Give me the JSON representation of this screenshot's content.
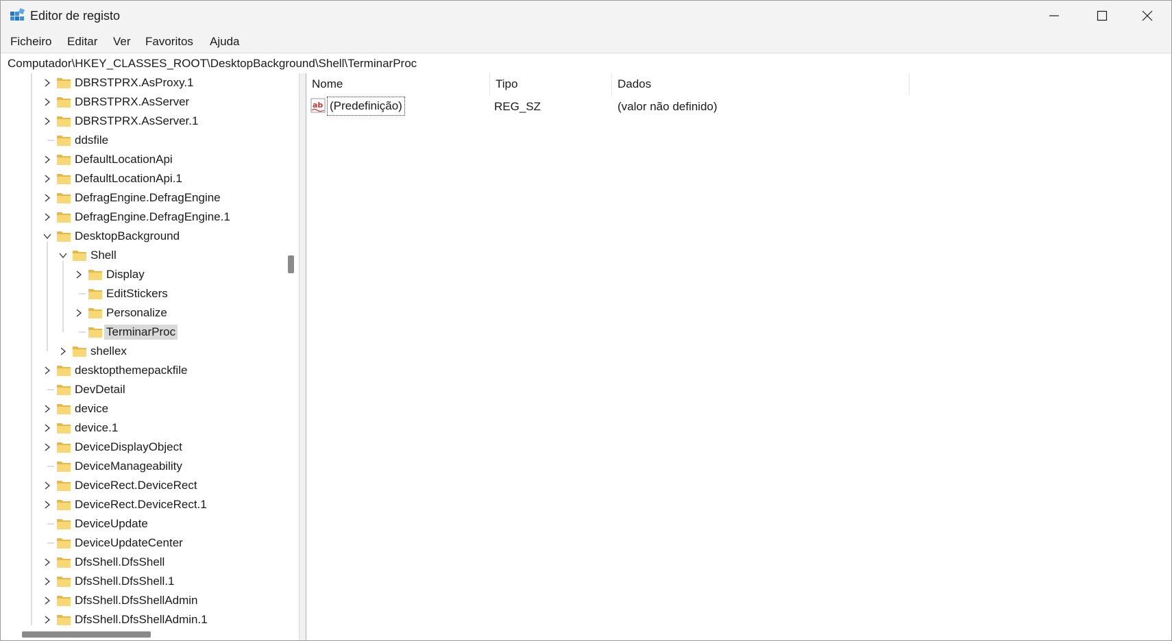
{
  "window": {
    "title": "Editor de registo"
  },
  "menu": [
    "Ficheiro",
    "Editar",
    "Ver",
    "Favoritos",
    "Ajuda"
  ],
  "address": "Computador\\HKEY_CLASSES_ROOT\\DesktopBackground\\Shell\\TerminarProc",
  "tree": [
    {
      "label": "DBRSTPRX.AsProxy.1",
      "level": 0,
      "expander": "collapsed"
    },
    {
      "label": "DBRSTPRX.AsServer",
      "level": 0,
      "expander": "collapsed"
    },
    {
      "label": "DBRSTPRX.AsServer.1",
      "level": 0,
      "expander": "collapsed"
    },
    {
      "label": "ddsfile",
      "level": 0,
      "expander": "none"
    },
    {
      "label": "DefaultLocationApi",
      "level": 0,
      "expander": "collapsed"
    },
    {
      "label": "DefaultLocationApi.1",
      "level": 0,
      "expander": "collapsed"
    },
    {
      "label": "DefragEngine.DefragEngine",
      "level": 0,
      "expander": "collapsed"
    },
    {
      "label": "DefragEngine.DefragEngine.1",
      "level": 0,
      "expander": "collapsed"
    },
    {
      "label": "DesktopBackground",
      "level": 0,
      "expander": "expanded"
    },
    {
      "label": "Shell",
      "level": 1,
      "expander": "expanded"
    },
    {
      "label": "Display",
      "level": 2,
      "expander": "collapsed"
    },
    {
      "label": "EditStickers",
      "level": 2,
      "expander": "none"
    },
    {
      "label": "Personalize",
      "level": 2,
      "expander": "collapsed"
    },
    {
      "label": "TerminarProc",
      "level": 2,
      "expander": "none",
      "selected": true
    },
    {
      "label": "shellex",
      "level": 1,
      "expander": "collapsed"
    },
    {
      "label": "desktopthemepackfile",
      "level": 0,
      "expander": "collapsed"
    },
    {
      "label": "DevDetail",
      "level": 0,
      "expander": "none"
    },
    {
      "label": "device",
      "level": 0,
      "expander": "collapsed"
    },
    {
      "label": "device.1",
      "level": 0,
      "expander": "collapsed"
    },
    {
      "label": "DeviceDisplayObject",
      "level": 0,
      "expander": "collapsed"
    },
    {
      "label": "DeviceManageability",
      "level": 0,
      "expander": "none"
    },
    {
      "label": "DeviceRect.DeviceRect",
      "level": 0,
      "expander": "collapsed"
    },
    {
      "label": "DeviceRect.DeviceRect.1",
      "level": 0,
      "expander": "collapsed"
    },
    {
      "label": "DeviceUpdate",
      "level": 0,
      "expander": "none"
    },
    {
      "label": "DeviceUpdateCenter",
      "level": 0,
      "expander": "none"
    },
    {
      "label": "DfsShell.DfsShell",
      "level": 0,
      "expander": "collapsed"
    },
    {
      "label": "DfsShell.DfsShell.1",
      "level": 0,
      "expander": "collapsed"
    },
    {
      "label": "DfsShell.DfsShellAdmin",
      "level": 0,
      "expander": "collapsed"
    },
    {
      "label": "DfsShell.DfsShellAdmin.1",
      "level": 0,
      "expander": "collapsed"
    }
  ],
  "list": {
    "columns": [
      "Nome",
      "Tipo",
      "Dados"
    ],
    "rows": [
      {
        "name": "(Predefinição)",
        "type": "REG_SZ",
        "data": "(valor não definido)",
        "icon": "string-value-icon"
      }
    ]
  },
  "colors": {
    "folder": "#f8d775",
    "folder_dark": "#e6b84a",
    "selected_bg": "#d9d9d9",
    "icon_blue": "#1e73d2"
  }
}
